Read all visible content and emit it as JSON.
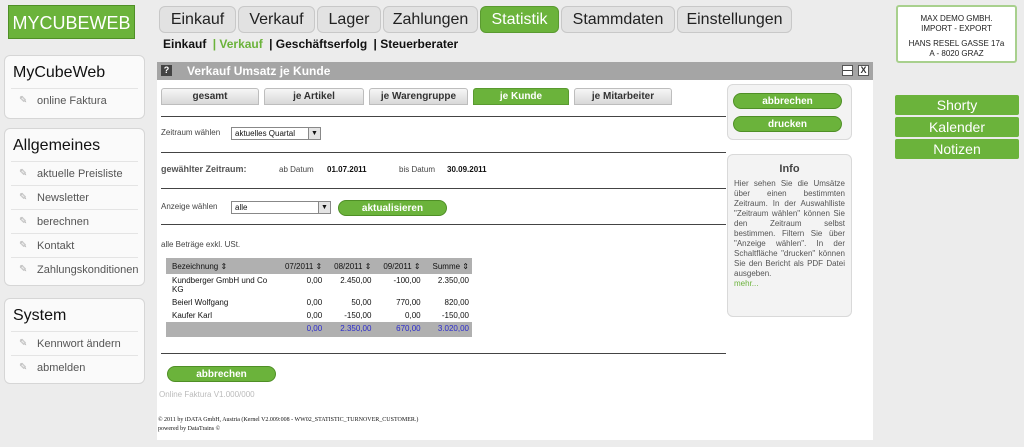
{
  "logo": "MYCUBEWEB",
  "sidebar": {
    "sections": [
      {
        "title": "MyCubeWeb",
        "items": [
          "online Faktura"
        ]
      },
      {
        "title": "Allgemeines",
        "items": [
          "aktuelle Preisliste",
          "Newsletter",
          "berechnen",
          "Kontakt",
          "Zahlungskonditionen"
        ]
      },
      {
        "title": "System",
        "items": [
          "Kennwort ändern",
          "abmelden"
        ]
      }
    ]
  },
  "main_tabs": [
    "Einkauf",
    "Verkauf",
    "Lager",
    "Zahlungen",
    "Statistik",
    "Stammdaten",
    "Einstellungen"
  ],
  "active_main_tab": "Statistik",
  "subnav": [
    "Einkauf",
    "| Verkauf",
    "| Geschäftserfolg",
    "| Steuerberater"
  ],
  "company": {
    "line1": "MAX DEMO GMBH.",
    "line2": "IMPORT - EXPORT",
    "line3": "HANS RESEL GASSE 17a",
    "line4": "A - 8020 GRAZ"
  },
  "right_buttons": [
    "Shorty",
    "Kalender",
    "Notizen"
  ],
  "window": {
    "help_icon": "?",
    "title": "Verkauf Umsatz je Kunde",
    "minimize": "—",
    "close": "X"
  },
  "sub_tabs": [
    "gesamt",
    "je Artikel",
    "je Warengruppe",
    "je Kunde",
    "je Mitarbeiter"
  ],
  "active_sub_tab": "je Kunde",
  "form": {
    "zeitraum_label": "Zeitraum wählen",
    "zeitraum_value": "aktuelles Quartal",
    "gewaehlt_label": "gewählter Zeitraum:",
    "ab_label": "ab Datum",
    "ab_value": "01.07.2011",
    "bis_label": "bis Datum",
    "bis_value": "30.09.2011",
    "anzeige_label": "Anzeige wählen",
    "anzeige_value": "alle",
    "aktualisieren": "aktualisieren",
    "note": "alle Beträge exkl. USt."
  },
  "table": {
    "headers": [
      "Bezeichnung",
      "07/2011",
      "08/2011",
      "09/2011",
      "Summe"
    ],
    "rows": [
      [
        "Kundberger GmbH und Co KG",
        "0,00",
        "2.450,00",
        "-100,00",
        "2.350,00"
      ],
      [
        "Beierl Wolfgang",
        "0,00",
        "50,00",
        "770,00",
        "820,00"
      ],
      [
        "Kaufer Karl",
        "0,00",
        "-150,00",
        "0,00",
        "-150,00"
      ]
    ],
    "sum": [
      "",
      "0,00",
      "2.350,00",
      "670,00",
      "3.020,00"
    ]
  },
  "actions": {
    "abbrechen": "abbrechen",
    "drucken": "drucken",
    "abbrechen_bottom": "abbrechen"
  },
  "info": {
    "title": "Info",
    "text": "Hier sehen Sie die Umsätze über einen bestimmten Zeitraum. In der Auswahlliste \"Zeitraum wählen\" können Sie den Zeitraum selbst bestimmen. Filtern Sie über \"Anzeige wählen\". In der Schaltfläche \"drucken\" können Sie den Bericht als PDF Datei ausgeben.",
    "more": "mehr..."
  },
  "footer": {
    "version": "Online Faktura V1.000/000",
    "copyright": "© 2011 by iDATA GmbH, Austria (Kernel V2.009:008 - WW02_STATISTIC_TURNOVER_CUSTOMER.)",
    "powered": "powered by DataTrains ©"
  },
  "colors": {
    "accent": "#6bb33b",
    "sum_text": "#2a2acc",
    "window_bar": "#a5a5a5"
  }
}
